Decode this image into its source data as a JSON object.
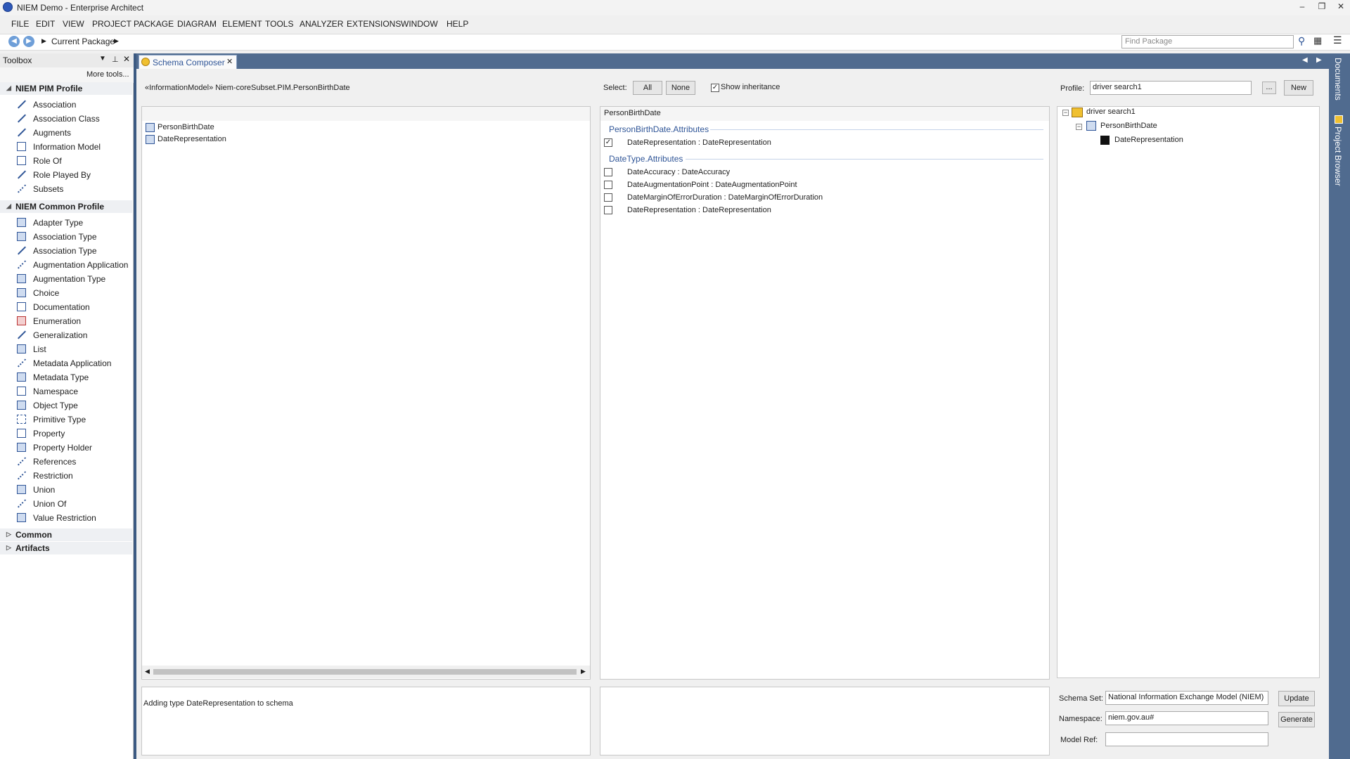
{
  "window": {
    "title": "NIEM Demo - Enterprise Architect"
  },
  "menu": [
    "FILE",
    "EDIT",
    "VIEW",
    "PROJECT",
    "PACKAGE",
    "DIAGRAM",
    "ELEMENT",
    "TOOLS",
    "ANALYZER",
    "EXTENSIONS",
    "WINDOW",
    "HELP"
  ],
  "nav": {
    "location": "Current Package",
    "find_placeholder": "Find Package"
  },
  "toolbox": {
    "title": "Toolbox",
    "more_tools": "More tools...",
    "groups": [
      {
        "name": "NIEM PIM Profile",
        "items": [
          "Association",
          "Association Class",
          "Augments",
          "Information Model",
          "Role Of",
          "Role Played By",
          "Subsets"
        ]
      },
      {
        "name": "NIEM Common Profile",
        "items": [
          "Adapter Type",
          "Association Type",
          "Association Type",
          "Augmentation Application",
          "Augmentation Type",
          "Choice",
          "Documentation",
          "Enumeration",
          "Generalization",
          "List",
          "Metadata Application",
          "Metadata Type",
          "Namespace",
          "Object Type",
          "Primitive Type",
          "Property",
          "Property Holder",
          "References",
          "Restriction",
          "Union",
          "Union Of",
          "Value Restriction"
        ]
      },
      {
        "name": "Common"
      },
      {
        "name": "Artifacts"
      }
    ]
  },
  "tab": {
    "label": "Schema Composer"
  },
  "side": {
    "documents": "Documents",
    "project_browser": "Project Browser"
  },
  "composer": {
    "model_path": "«InformationModel» Niem-coreSubset.PIM.PersonBirthDate",
    "select_label": "Select:",
    "all_button": "All",
    "none_button": "None",
    "show_inheritance": "Show inheritance",
    "profile_label": "Profile:",
    "profile_value": "driver search1",
    "ellipsis": "...",
    "new_button": "New",
    "classes": [
      "PersonBirthDate",
      "DateRepresentation"
    ],
    "attributes_header": "PersonBirthDate",
    "sections": [
      {
        "title": "PersonBirthDate.Attributes",
        "items": [
          {
            "label": "DateRepresentation : DateRepresentation",
            "checked": true
          }
        ]
      },
      {
        "title": "DateType.Attributes",
        "items": [
          {
            "label": "DateAccuracy : DateAccuracy",
            "checked": false
          },
          {
            "label": "DateAugmentationPoint : DateAugmentationPoint",
            "checked": false
          },
          {
            "label": "DateMarginOfErrorDuration : DateMarginOfErrorDuration",
            "checked": false
          },
          {
            "label": "DateRepresentation : DateRepresentation",
            "checked": false
          }
        ]
      }
    ],
    "tree": {
      "root": "driver search1",
      "child": "PersonBirthDate",
      "leaf": "DateRepresentation"
    },
    "log_message": "Adding type DateRepresentation to schema",
    "schema_set_label": "Schema Set:",
    "schema_set_value": "National Information Exchange Model (NIEM)",
    "update_button": "Update",
    "namespace_label": "Namespace:",
    "namespace_value": "niem.gov.au#",
    "generate_button": "Generate",
    "model_ref_label": "Model Ref:",
    "model_ref_value": ""
  },
  "colors": {
    "accent": "#2f5597",
    "tab_strip": "#506b8f"
  }
}
